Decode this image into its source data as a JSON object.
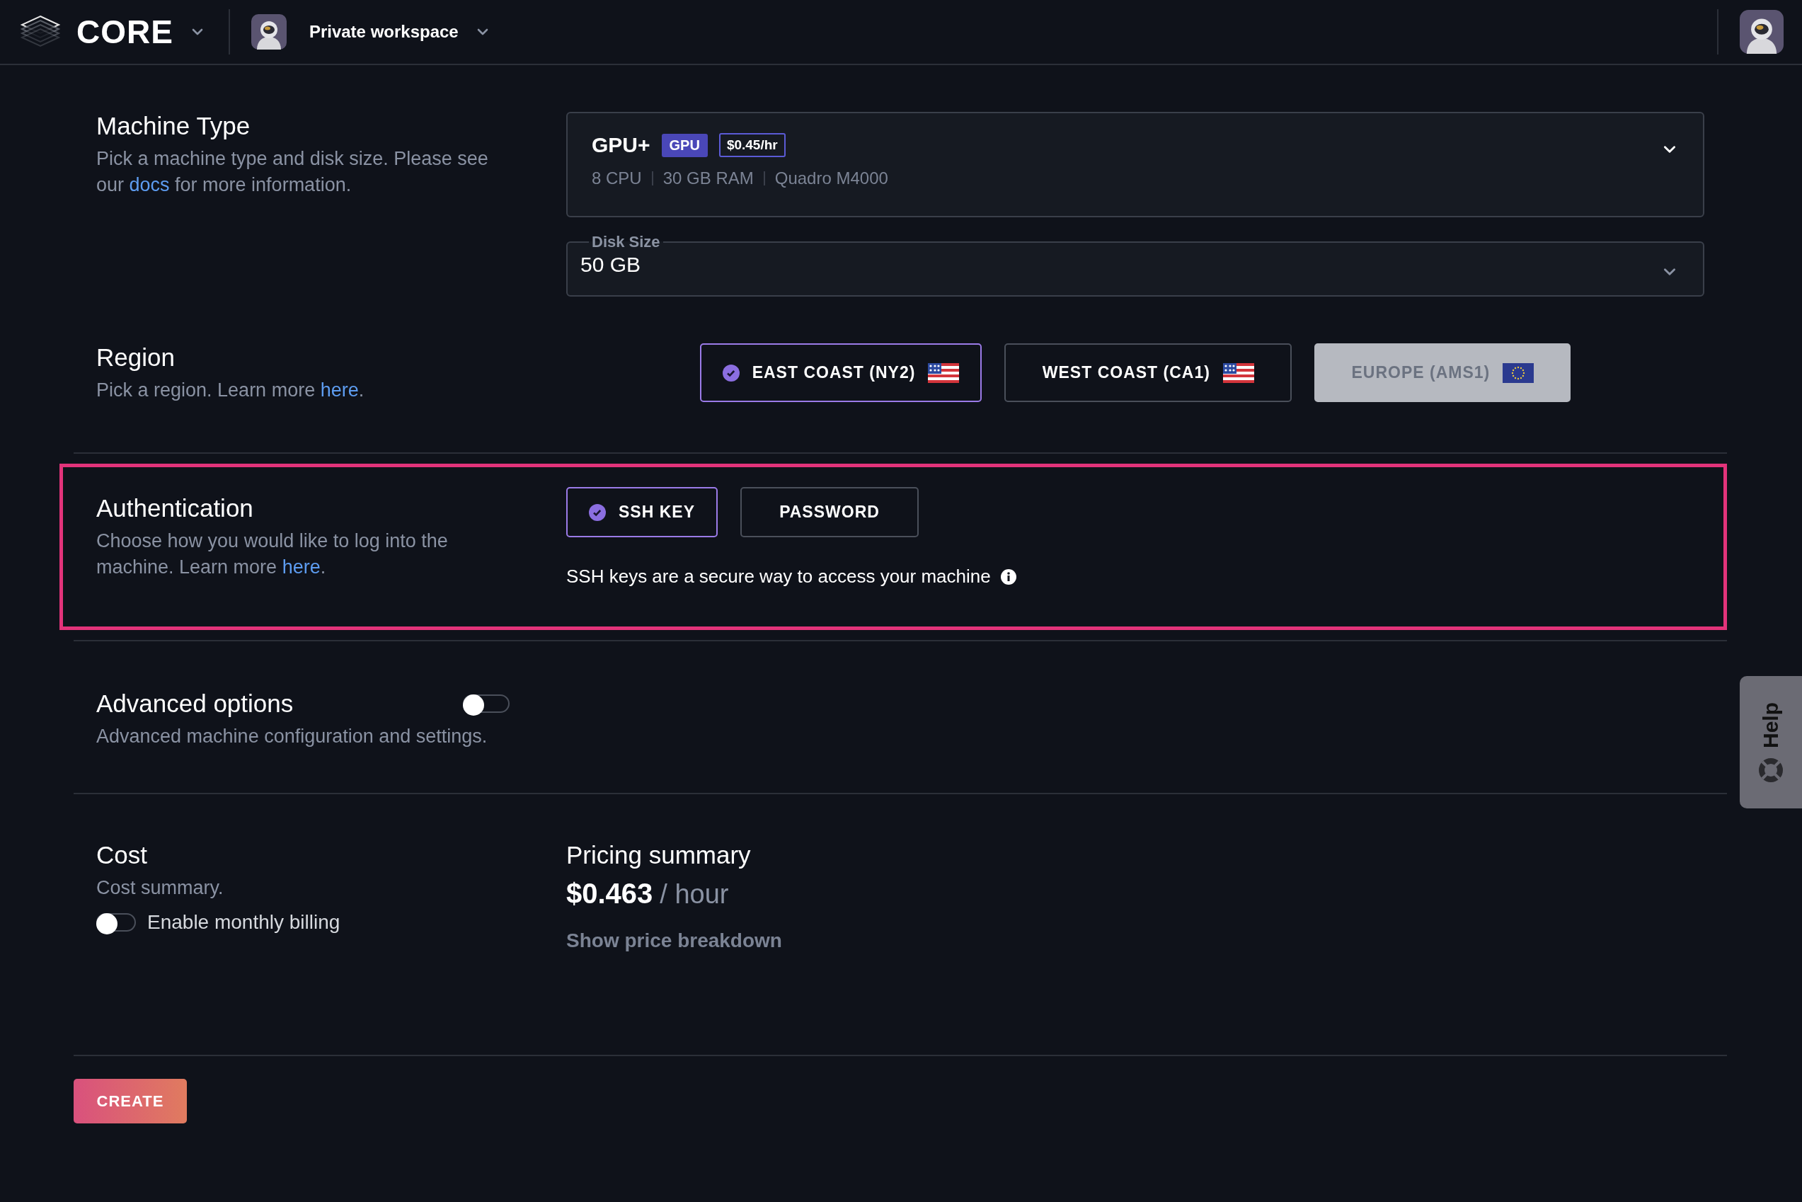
{
  "header": {
    "brand": "CORE",
    "workspace": "Private workspace"
  },
  "machine": {
    "title": "Machine Type",
    "description": {
      "before": "Pick a machine type and disk size. Please see our ",
      "link": "docs",
      "after": " for more information."
    },
    "type": {
      "name": "GPU+",
      "badge": "GPU",
      "price": "$0.45/hr",
      "specs": [
        "8 CPU",
        "30 GB RAM",
        "Quadro M4000"
      ]
    },
    "disk": {
      "label": "Disk Size",
      "value": "50 GB"
    }
  },
  "region": {
    "title": "Region",
    "description": {
      "before": "Pick a region. Learn more ",
      "link": "here",
      "after": "."
    },
    "options": [
      {
        "label": "EAST COAST (NY2)",
        "kind": "us",
        "selected": true,
        "disabled": false
      },
      {
        "label": "WEST COAST (CA1)",
        "kind": "us",
        "selected": false,
        "disabled": false
      },
      {
        "label": "EUROPE (AMS1)",
        "kind": "eu",
        "selected": false,
        "disabled": true
      }
    ]
  },
  "authentication": {
    "title": "Authentication",
    "highlighted": true,
    "description": {
      "before": "Choose how you would like to log into the machine. Learn more ",
      "link": "here",
      "after": "."
    },
    "options": [
      {
        "label": "SSH KEY",
        "selected": true
      },
      {
        "label": "PASSWORD",
        "selected": false
      }
    ],
    "note": "SSH keys are a secure way to access your machine"
  },
  "advanced": {
    "title": "Advanced options",
    "description": "Advanced machine configuration and settings.",
    "on": false
  },
  "cost": {
    "title": "Cost",
    "description": "Cost summary.",
    "monthly_billing": {
      "label": "Enable monthly billing",
      "on": false
    },
    "pricing": {
      "title": "Pricing summary",
      "amount": "$0.463",
      "unit": "/ hour",
      "link": "Show price breakdown"
    }
  },
  "create": "CREATE",
  "help": "Help"
}
